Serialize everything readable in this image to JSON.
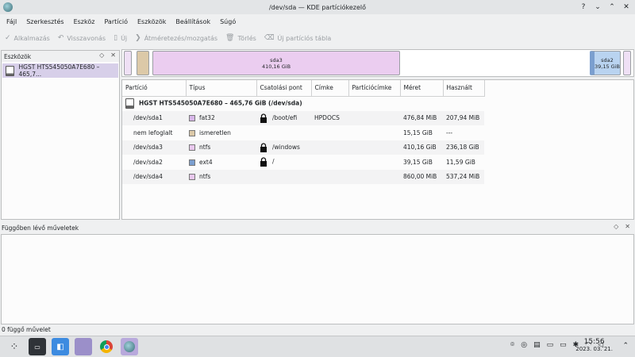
{
  "window": {
    "title": "/dev/sda — KDE partíciókezelő"
  },
  "menu": [
    "Fájl",
    "Szerkesztés",
    "Eszköz",
    "Partíció",
    "Eszközök",
    "Beállítások",
    "Súgó"
  ],
  "toolbar": {
    "apply": "Alkalmazás",
    "undo": "Visszavonás",
    "new": "Új",
    "resize": "Átméretezés/mozgatás",
    "delete": "Törlés",
    "new_table": "Új partíciós tábla"
  },
  "devices": {
    "title": "Eszközök",
    "items": [
      {
        "label": "HGST HTS545050A7E680 – 465,7..."
      }
    ]
  },
  "partition_bar": {
    "sda3": {
      "name": "sda3",
      "size": "410,16 GiB"
    },
    "sda2": {
      "name": "sda2",
      "size": "39,15 GiB"
    }
  },
  "table": {
    "headers": [
      "Partíció",
      "Típus",
      "Csatolási pont",
      "Címke",
      "Partíciócímke",
      "Méret",
      "Használt"
    ],
    "disk_label": "HGST HTS545050A7E680 – 465,76 GiB (/dev/sda)",
    "rows": [
      {
        "partition": "/dev/sda1",
        "type": "fat32",
        "mount": "/boot/efi",
        "label": "HPDOCS",
        "part_label": "",
        "size": "476,84 MiB",
        "used": "207,94 MiB"
      },
      {
        "partition": "nem lefoglalt",
        "type": "ismeretlen",
        "mount": "",
        "label": "",
        "part_label": "",
        "size": "15,15 GiB",
        "used": "---"
      },
      {
        "partition": "/dev/sda3",
        "type": "ntfs",
        "mount": "/windows",
        "label": "",
        "part_label": "",
        "size": "410,16 GiB",
        "used": "236,18 GiB"
      },
      {
        "partition": "/dev/sda2",
        "type": "ext4",
        "mount": "/",
        "label": "",
        "part_label": "",
        "size": "39,15 GiB",
        "used": "11,59 GiB"
      },
      {
        "partition": "/dev/sda4",
        "type": "ntfs",
        "mount": "",
        "label": "",
        "part_label": "",
        "size": "860,00 MiB",
        "used": "537,24 MiB"
      }
    ]
  },
  "pending": {
    "title": "Függőben lévő műveletek"
  },
  "status": {
    "text": "0 függő művelet"
  },
  "taskbar": {
    "time": "15:56",
    "date": "2023. 03. 21."
  },
  "colors": {
    "fat32": "#d7b6e9",
    "ismeretlen": "#dcc9a8",
    "ntfs": "#e9c8ee",
    "ext4": "#7b9fcf",
    "selection": "#d7cfe9"
  }
}
